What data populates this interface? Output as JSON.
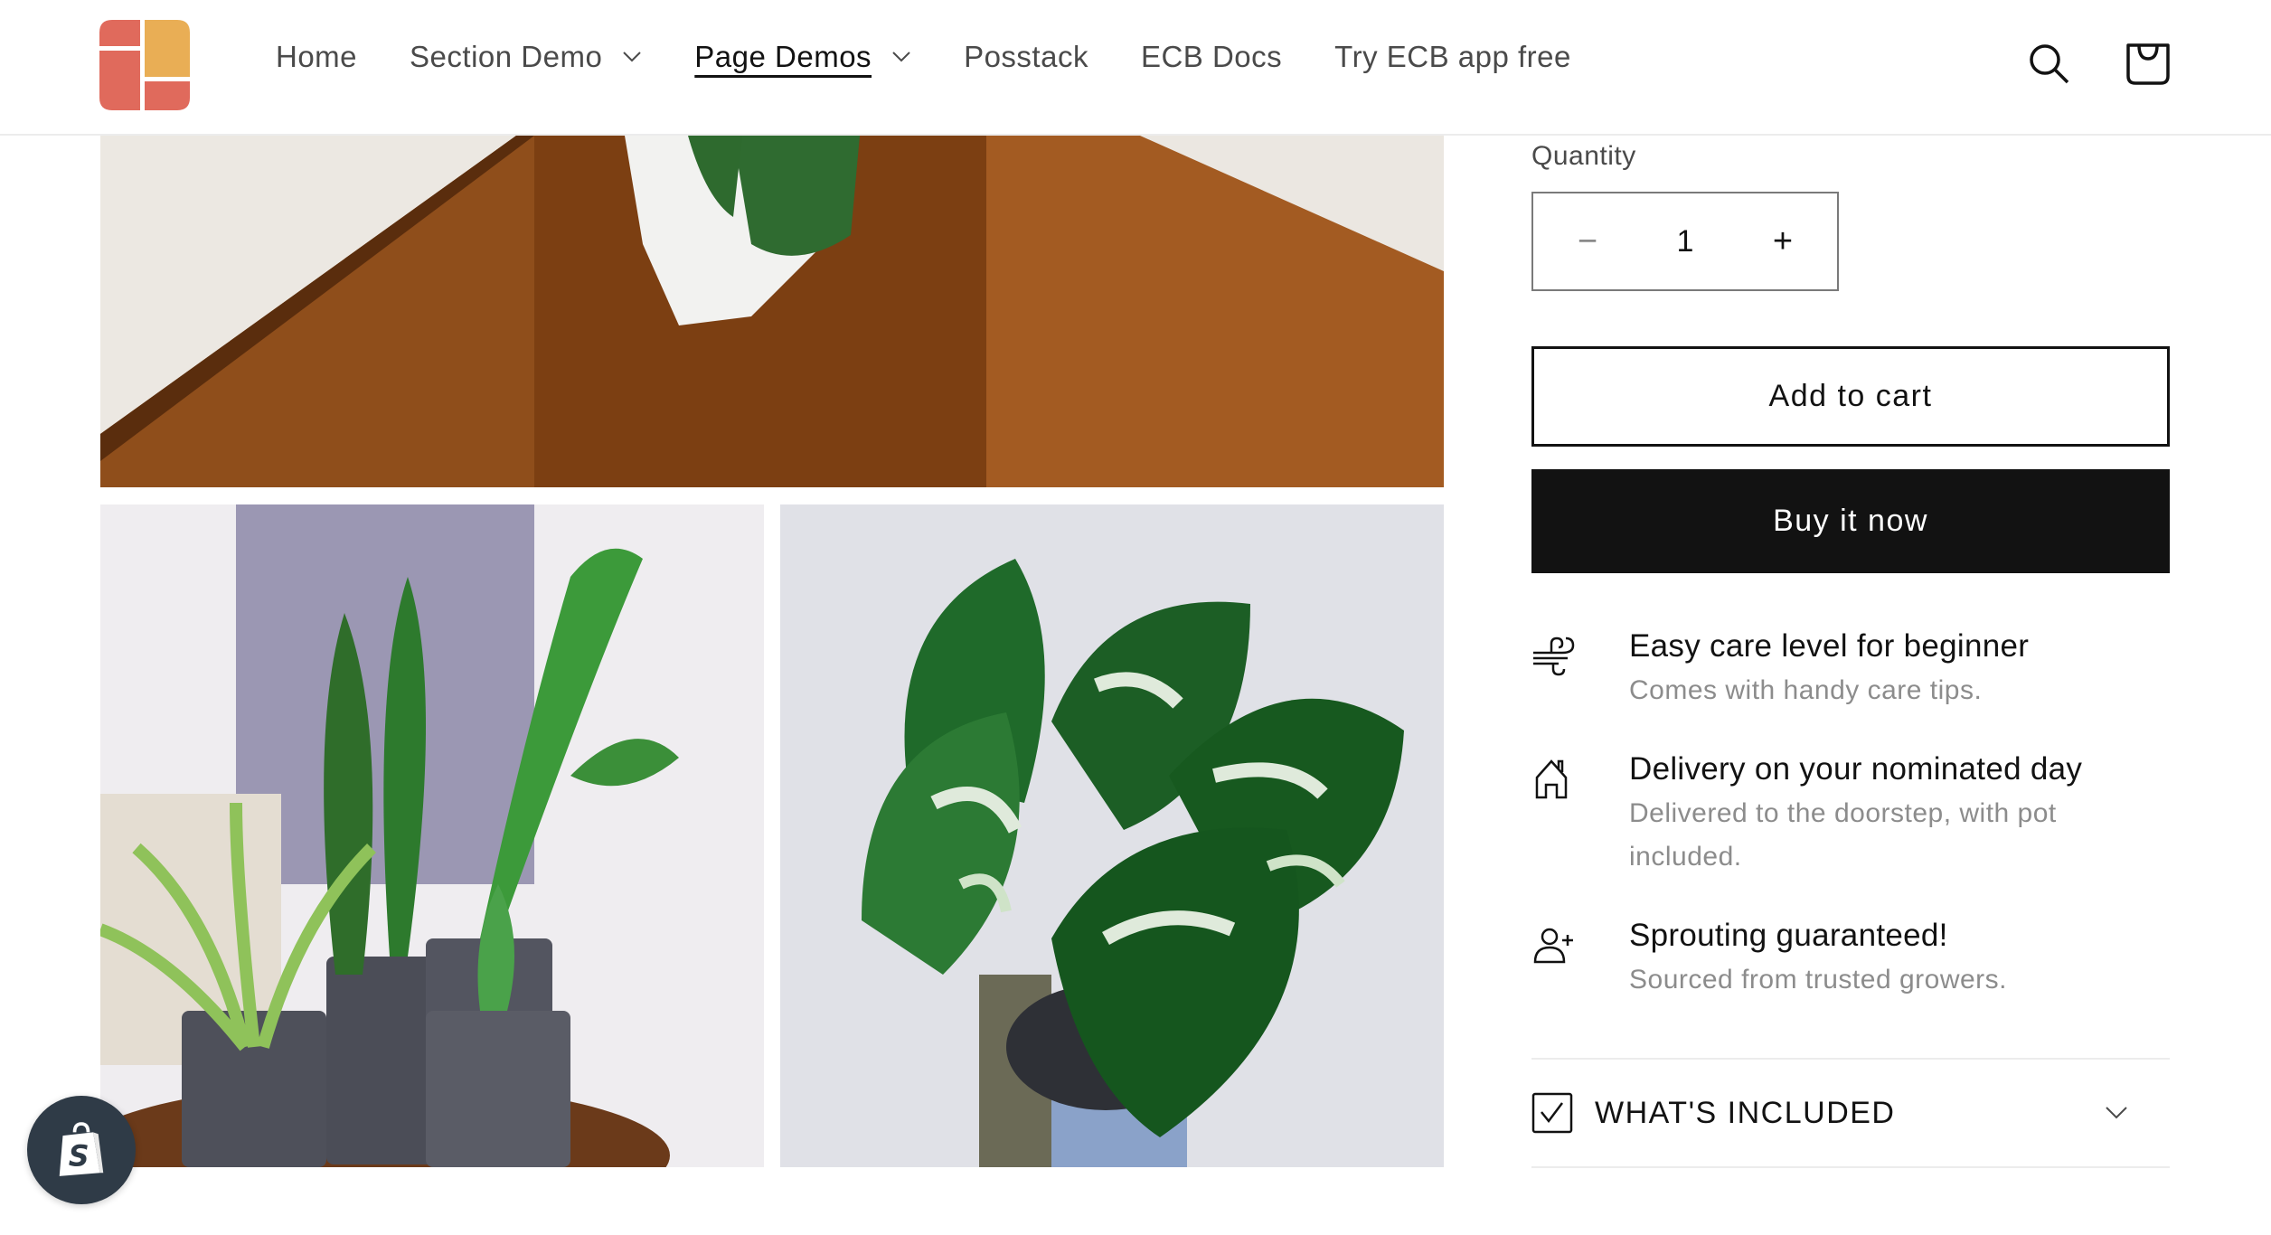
{
  "header": {
    "logo_alt": "ECB logo",
    "nav": [
      {
        "label": "Home",
        "has_dropdown": false,
        "active": false
      },
      {
        "label": "Section Demo",
        "has_dropdown": true,
        "active": false
      },
      {
        "label": "Page Demos",
        "has_dropdown": true,
        "active": true
      },
      {
        "label": "Posstack",
        "has_dropdown": false,
        "active": false
      },
      {
        "label": "ECB Docs",
        "has_dropdown": false,
        "active": false
      },
      {
        "label": "Try ECB app free",
        "has_dropdown": false,
        "active": false
      }
    ],
    "icons": [
      "search-icon",
      "cart-icon"
    ]
  },
  "gallery": {
    "images": [
      {
        "alt": "Monstera in white pot on wooden stairs"
      },
      {
        "alt": "Assorted potted plants in grey pots"
      },
      {
        "alt": "Person holding variegated monstera"
      }
    ]
  },
  "product": {
    "quantity_label": "Quantity",
    "quantity_value": "1",
    "decrease_symbol": "−",
    "increase_symbol": "+",
    "add_to_cart_label": "Add to cart",
    "buy_now_label": "Buy it now",
    "features": [
      {
        "icon": "wind-icon",
        "title": "Easy care level for beginner",
        "description": "Comes with handy care tips."
      },
      {
        "icon": "house-icon",
        "title": "Delivery on your nominated day",
        "description": "Delivered to the doorstep, with pot included."
      },
      {
        "icon": "add-user-icon",
        "title": "Sprouting guaranteed!",
        "description": "Sourced from trusted growers."
      }
    ],
    "accordion": {
      "icon": "checkbox-icon",
      "label": "WHAT'S INCLUDED",
      "expanded": false
    }
  },
  "colors": {
    "logo_red": "#e06a5c",
    "logo_orange": "#e9ae55",
    "primary": "#121212",
    "muted_text": "#8c8c8c",
    "shopify_badge": "#2f3b47"
  }
}
